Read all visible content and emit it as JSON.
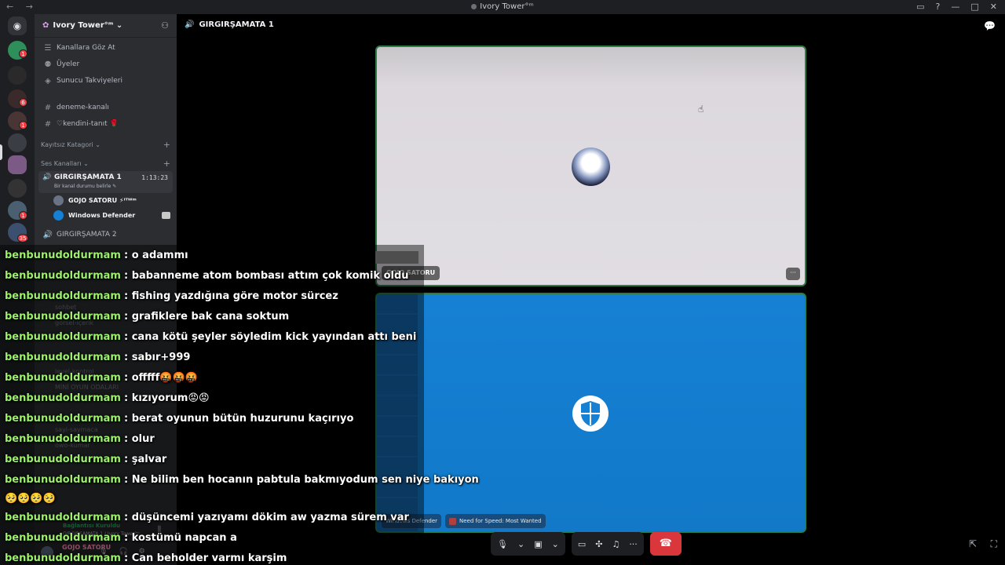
{
  "window": {
    "title": "Ivory Tower°ᵐ",
    "nav": "← →",
    "icons": [
      "inbox-icon",
      "help-icon",
      "minimize-icon",
      "maximize-icon",
      "close-icon"
    ]
  },
  "server": {
    "name": "Ivory Tower°ᵐ ⌄"
  },
  "sidebar": {
    "top_items": [
      {
        "label": "Kanallara Göz At",
        "icon": "browse-channels-icon"
      },
      {
        "label": "Üyeler",
        "icon": "members-icon"
      },
      {
        "label": "Sunucu Takviyeleri",
        "icon": "boost-icon"
      }
    ],
    "text_channels": [
      {
        "label": "deneme-kanalı"
      },
      {
        "label": "♡kendini-tanıt 🌹"
      }
    ],
    "categories": {
      "uncategorized": "Kayıtsız Katagori ⌄",
      "voice": "Ses Kanalları ⌄"
    },
    "active_voice": {
      "name": "GIRGIRŞAMATA 1",
      "timer": "1:13:23",
      "status": "Bir kanal durumu belirle ✎",
      "members": [
        {
          "name": "GOJO SATORU ⚡ᴵᵀᵂᵐ"
        },
        {
          "name": "Windows Defender"
        }
      ]
    },
    "voice_channels": [
      {
        "label": "GIRGIRŞAMATA 2"
      }
    ],
    "hidden_channels": [
      "sohbet",
      "görsel-içerik",
      "müzik",
      "level-kontrol",
      "MİNİ OYUN ODALARI",
      "sayi-saymaca",
      "owo-kumar",
      "bom"
    ],
    "rtc": {
      "status": "Bağlantısı Kuruldu",
      "channel": "GIRGIRŞAMATA 1 / Ivory Tower°ᵐ"
    },
    "user": {
      "name": "GOJO SATORU"
    }
  },
  "main": {
    "channel_title": "GIRGIRŞAMATA 1",
    "tiles": [
      {
        "name": "GOJO SATORU"
      },
      {
        "name": "Windows Defender",
        "activity": "Need for Speed: Most Wanted"
      }
    ],
    "controls": {
      "more": "···"
    }
  },
  "overlay": {
    "messages": [
      {
        "user": "benbunudoldurmam",
        "text": ": o adammı"
      },
      {
        "user": "benbunudoldurmam",
        "text": ": babanneme atom bombası attım çok komik oldu"
      },
      {
        "user": "benbunudoldurmam",
        "text": ": fishing yazdığına göre motor sürcez"
      },
      {
        "user": "benbunudoldurmam",
        "text": ": grafiklere bak cana soktum"
      },
      {
        "user": "benbunudoldurmam",
        "text": ": cana kötü şeyler söyledim kick yayından attı beni"
      },
      {
        "user": "benbunudoldurmam",
        "text": ": sabır+999"
      },
      {
        "user": "benbunudoldurmam",
        "text": ": offfff🤬🤬🤬"
      },
      {
        "user": "benbunudoldurmam",
        "text": ": kızıyorum😡😡"
      },
      {
        "user": "benbunudoldurmam",
        "text": ": berat oyunun bütün huzurunu kaçırıyo"
      },
      {
        "user": "benbunudoldurmam",
        "text": ": olur"
      },
      {
        "user": "benbunudoldurmam",
        "text": ": şalvar"
      },
      {
        "user": "benbunudoldurmam",
        "text": ": Ne bilim ben hocanın pabtula bakmıyodum sen niye bakıyon"
      },
      {
        "user": "",
        "text": "🥺🥺🥺🥺"
      },
      {
        "user": "benbunudoldurmam",
        "text": ": düşüncemi yazıyamı dökim aw yazma sürem var"
      },
      {
        "user": "benbunudoldurmam",
        "text": ": kostümü napcan a"
      },
      {
        "user": "benbunudoldurmam",
        "text": ": Can beholder varmı karşim"
      }
    ]
  },
  "colors": {
    "accent_green": "#2d7d46",
    "chat_user": "#9cf06c",
    "hangup": "#da373c",
    "defender_blue": "#1680d4"
  }
}
